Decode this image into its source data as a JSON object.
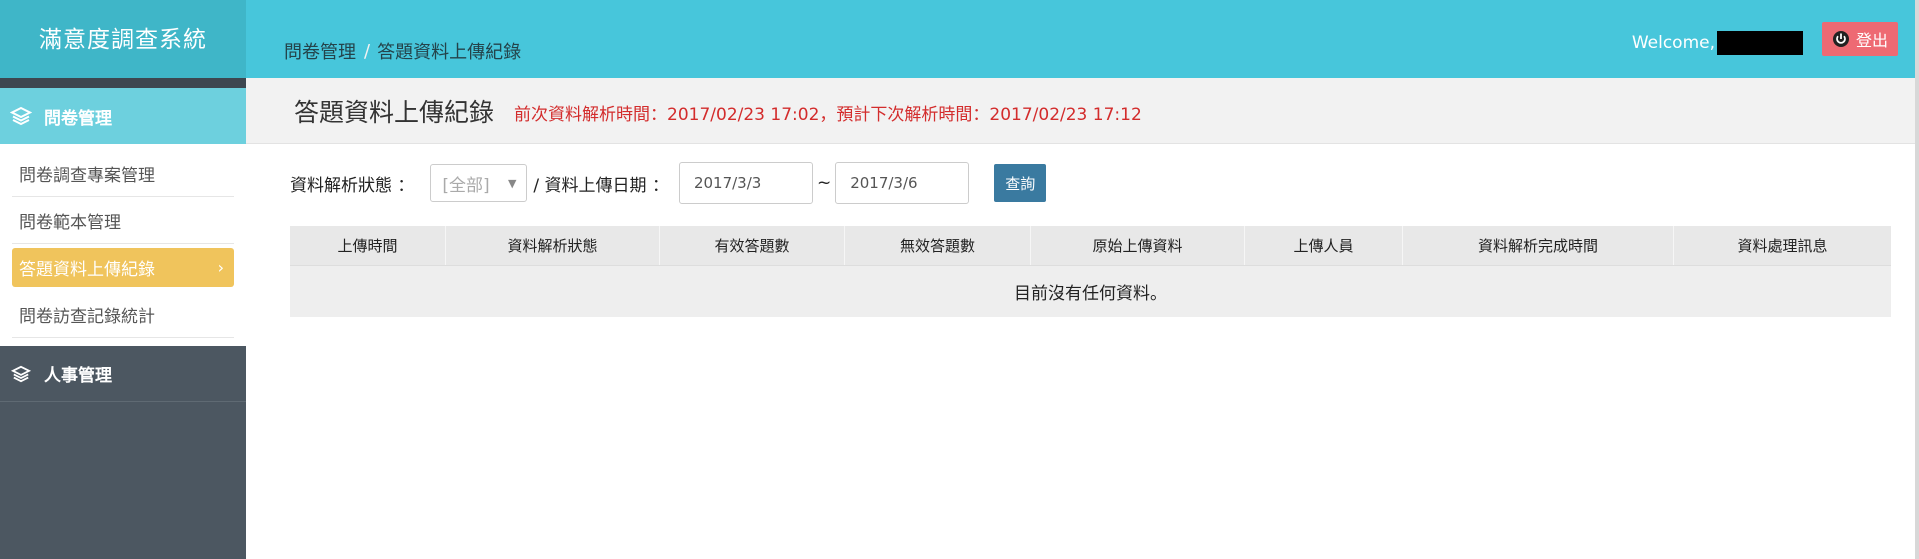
{
  "app": {
    "title": "滿意度調查系統"
  },
  "sidebar": {
    "groups": [
      {
        "label": "問卷管理",
        "icon": "layers-icon",
        "items": [
          {
            "label": "問卷調查專案管理"
          },
          {
            "label": "問卷範本管理"
          },
          {
            "label": "答題資料上傳紀錄",
            "active": true,
            "chevron": "›"
          },
          {
            "label": "問卷訪查記錄統計"
          }
        ]
      },
      {
        "label": "人事管理",
        "icon": "layers-icon",
        "items": []
      }
    ]
  },
  "header": {
    "breadcrumb": [
      "問卷管理",
      "答題資料上傳紀錄"
    ],
    "breadcrumb_sep": "/",
    "welcome": "Welcome,",
    "logout_label": "登出",
    "logout_icon": "power-icon"
  },
  "page": {
    "title": "答題資料上傳紀錄",
    "parse_note": "前次資料解析時間：2017/02/23 17:02，預計下次解析時間：2017/02/23 17:12"
  },
  "filter": {
    "status_label": "資料解析狀態 ：",
    "status_value": "[全部]",
    "date_label": "/ 資料上傳日期 ：",
    "date_from": "2017/3/3",
    "date_sep": "~",
    "date_to": "2017/3/6",
    "search_label": "查詢"
  },
  "table": {
    "columns": [
      "上傳時間",
      "資料解析狀態",
      "有效答題數",
      "無效答題數",
      "原始上傳資料",
      "上傳人員",
      "資料解析完成時間",
      "資料處理訊息"
    ],
    "empty_message": "目前沒有任何資料。"
  },
  "colors": {
    "header": "#47c6db",
    "brand": "#3fb6c8",
    "sidebar": "#4c5761",
    "active_group": "#6dd0de",
    "active_item": "#f0c45c",
    "logout": "#ee6a73",
    "note": "#d32c2c",
    "search_button": "#3a7aa0"
  }
}
